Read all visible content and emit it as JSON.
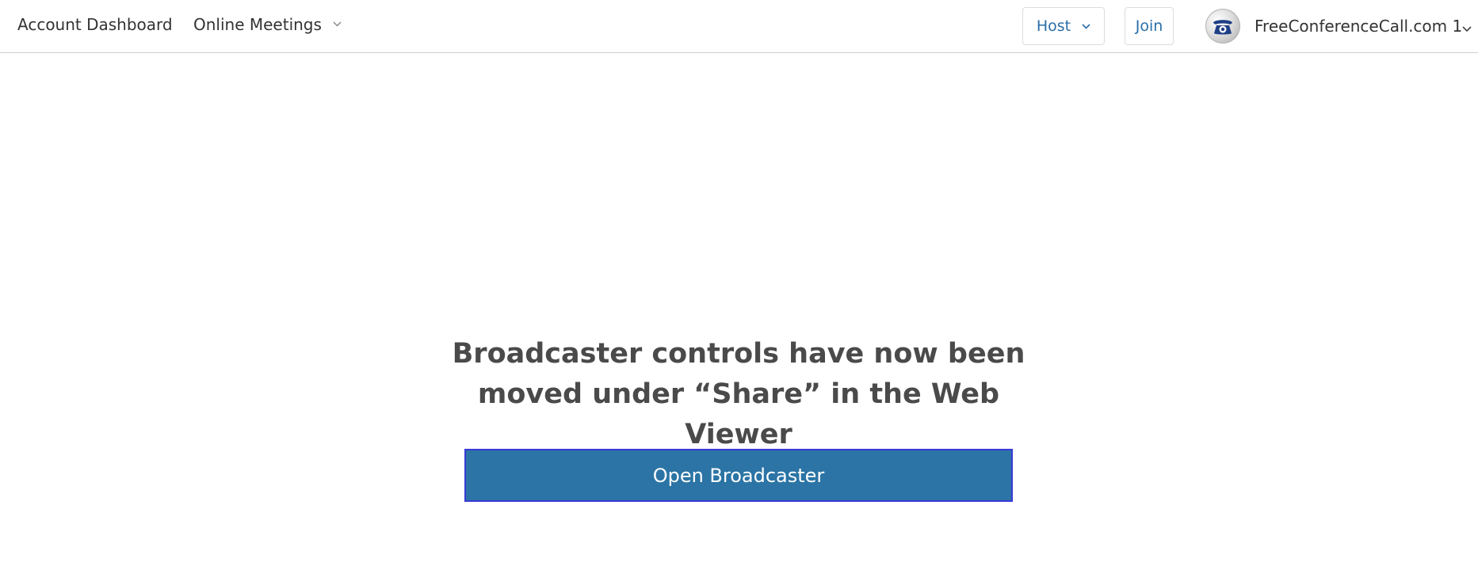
{
  "topbar": {
    "nav": {
      "dashboard_label": "Account Dashboard",
      "meetings_label": "Online Meetings"
    },
    "host_label": "Host",
    "join_label": "Join",
    "account": {
      "name": "FreeConferenceCall.com 1",
      "avatar_icon": "telephone-icon"
    }
  },
  "main": {
    "headline_line1": "Broadcaster controls have now been",
    "headline_line2": "moved under “Share” in the Web Viewer",
    "open_button_label": "Open Broadcaster"
  },
  "colors": {
    "primary_button": "#2b74a5",
    "focus_outline": "#3a3ad6",
    "link_blue": "#2a6ea8",
    "text": "#333333"
  }
}
